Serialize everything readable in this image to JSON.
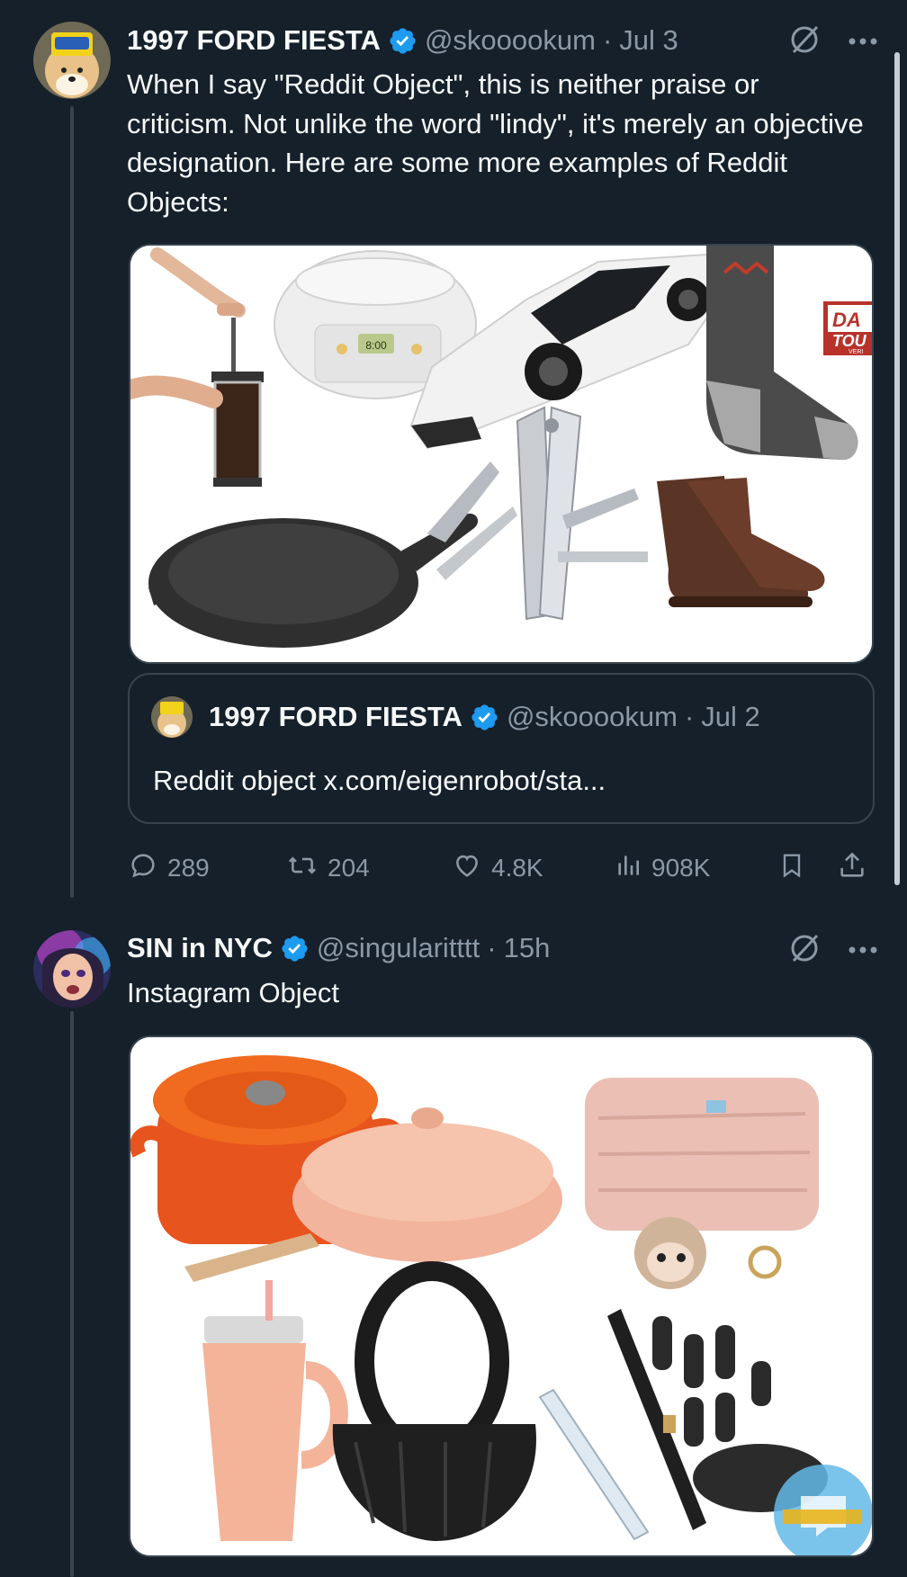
{
  "tweet1": {
    "name": "1997 FORD FIESTA",
    "handle": "@skooookum",
    "separator": "·",
    "time": "Jul 3",
    "text": "When I say \"Reddit Object\", this is neither praise or criticism. Not unlike the word \"lindy\", it's merely an objective designation. Here are some more examples of Reddit Objects:",
    "media_labels": {
      "sock_tag_1": "DA",
      "sock_tag_2": "TOU",
      "sock_tag_3": "VERI",
      "cooker_display": "8:00"
    },
    "quote": {
      "name": "1997 FORD FIESTA",
      "handle": "@skooookum",
      "separator": "·",
      "time": "Jul 2",
      "text": "Reddit object x.com/eigenrobot/sta..."
    },
    "actions": {
      "replies": "289",
      "reposts": "204",
      "likes": "4.8K",
      "views": "908K"
    }
  },
  "tweet2": {
    "name": "SIN in NYC",
    "handle": "@singularitttt",
    "separator": "·",
    "time": "15h",
    "text": "Instagram Object"
  },
  "colors": {
    "background": "#15202b",
    "verified": "#1d9bf0",
    "secondary_text": "#8b98a5",
    "border": "#38444d"
  },
  "icons": {
    "verified": "verified-badge-icon",
    "grok": "grok-icon",
    "more": "more-icon",
    "reply": "reply-icon",
    "repost": "repost-icon",
    "like": "like-icon",
    "views": "views-icon",
    "bookmark": "bookmark-icon",
    "share": "share-icon"
  }
}
